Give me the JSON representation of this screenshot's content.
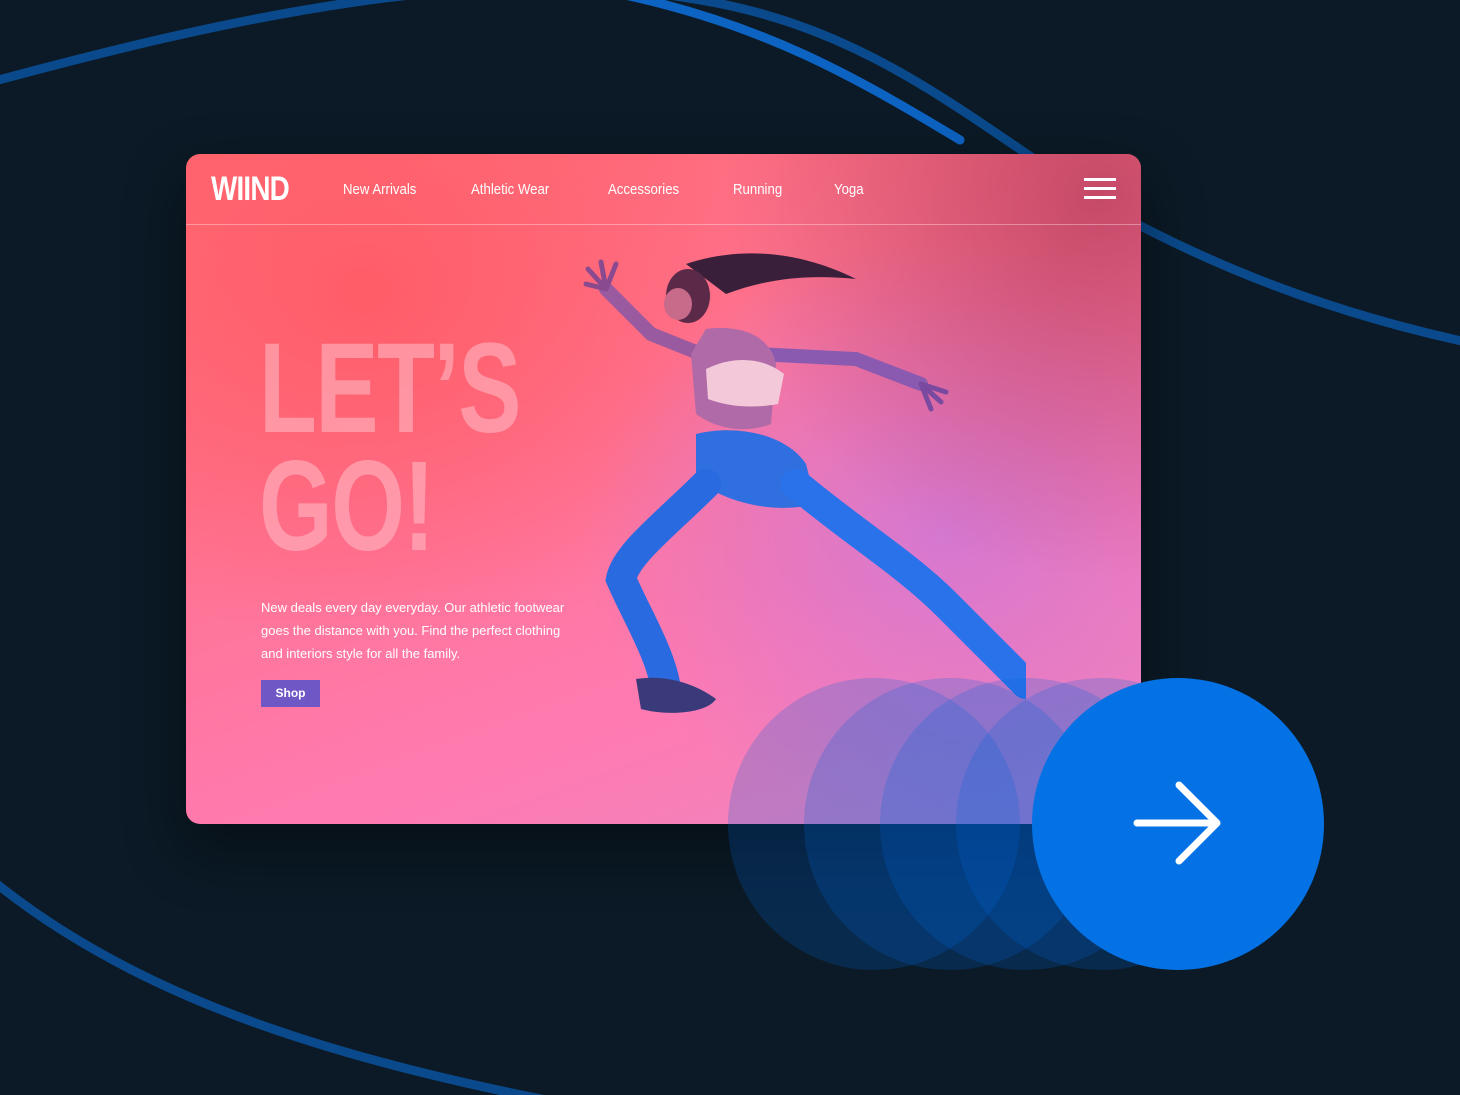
{
  "brand": {
    "logo": "WIIND"
  },
  "nav": {
    "items": [
      {
        "label": "New Arrivals"
      },
      {
        "label": "Athletic Wear"
      },
      {
        "label": "Accessories"
      },
      {
        "label": "Running"
      },
      {
        "label": "Yoga"
      }
    ],
    "menu_icon": "hamburger-menu-icon"
  },
  "hero": {
    "title_line1": "LET’S",
    "title_line2": "GO!",
    "description": "New deals every day everyday. Our athletic footwear goes the distance with you. Find the perfect clothing and interiors style for all the family.",
    "cta_label": "Shop"
  },
  "next_button": {
    "icon": "arrow-right-icon"
  },
  "colors": {
    "background": "#0b1a26",
    "accent_blue": "#0472e4",
    "cta_purple": "#6f57c6",
    "card_pink": "#ff7390"
  }
}
